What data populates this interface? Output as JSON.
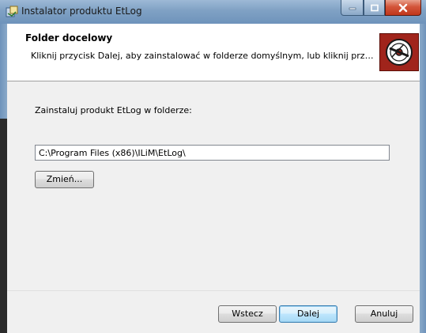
{
  "window": {
    "title": "Instalator produktu EtLog",
    "controls": {
      "minimize_icon": "minimize-icon",
      "maximize_icon": "maximize-icon",
      "close_icon": "close-icon"
    }
  },
  "header": {
    "title": "Folder docelowy",
    "subtitle": "Kliknij przycisk Dalej, aby zainstalować w folderze domyślnym, lub kliknij prz…",
    "logo_icon": "disc-icon"
  },
  "main": {
    "install_label": "Zainstaluj produkt EtLog w folderze:",
    "path_value": "C:\\Program Files (x86)\\ILiM\\EtLog\\",
    "change_button": "Zmień..."
  },
  "footer": {
    "back_button": "Wstecz",
    "next_button": "Dalej",
    "cancel_button": "Anuluj"
  },
  "colors": {
    "logo_bg": "#a0241b",
    "close_button": "#c1371c",
    "default_button_border": "#3c7fb1"
  }
}
